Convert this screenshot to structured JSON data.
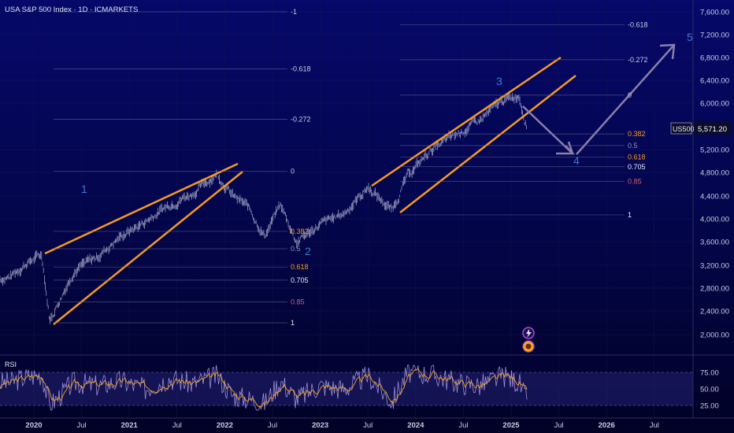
{
  "header": {
    "title": "USA S&P 500 Index · 1D · ICMARKETS"
  },
  "price_axis": {
    "ticks": [
      "7,600.00",
      "7,200.00",
      "6,800.00",
      "6,400.00",
      "6,000.00",
      "5,200.00",
      "4,800.00",
      "4,400.00",
      "4,000.00",
      "3,600.00",
      "3,200.00",
      "2,800.00",
      "2,400.00",
      "2,000.00"
    ],
    "tick_values": [
      7600,
      7200,
      6800,
      6400,
      6000,
      5200,
      4800,
      4400,
      4000,
      3600,
      3200,
      2800,
      2400,
      2000
    ],
    "symbol": "US500",
    "last_price": "5,571.20",
    "last_value": 5571.2
  },
  "time_axis": {
    "labels": [
      "2020",
      "Jul",
      "2021",
      "Jul",
      "2022",
      "Jul",
      "2023",
      "Jul",
      "2024",
      "Jul",
      "2025",
      "Jul",
      "2026",
      "Jul"
    ],
    "bold": [
      true,
      false,
      true,
      false,
      true,
      false,
      true,
      false,
      true,
      false,
      true,
      false,
      true,
      false
    ]
  },
  "rsi": {
    "label": "RSI",
    "ticks": [
      "75.00",
      "50.00",
      "25.00"
    ],
    "tick_values": [
      75,
      50,
      25
    ]
  },
  "fib_left": {
    "levels": [
      {
        "label": "-1",
        "value": 7600,
        "color": "#c8cde0"
      },
      {
        "label": "-0.618",
        "value": 6600,
        "color": "#c8cde0"
      },
      {
        "label": "-0.272",
        "value": 5720,
        "color": "#c8cde0"
      },
      {
        "label": "0",
        "value": 4820,
        "color": "#c8cde0"
      },
      {
        "label": "0.382",
        "value": 3780,
        "color": "#f59a23"
      },
      {
        "label": "0.5",
        "value": 3480,
        "color": "#9098b0"
      },
      {
        "label": "0.618",
        "value": 3170,
        "color": "#f59a23"
      },
      {
        "label": "0.705",
        "value": 2940,
        "color": "#e8ecf5"
      },
      {
        "label": "0.85",
        "value": 2560,
        "color": "#d0606a"
      },
      {
        "label": "1",
        "value": 2200,
        "color": "#e8ecf5"
      }
    ]
  },
  "fib_right": {
    "levels": [
      {
        "label": "-0.618",
        "value": 7370,
        "color": "#c8cde0"
      },
      {
        "label": "-0.272",
        "value": 6760,
        "color": "#c8cde0"
      },
      {
        "label": "0",
        "value": 6140,
        "color": "#c8cde0"
      },
      {
        "label": "0.382",
        "value": 5470,
        "color": "#f59a23"
      },
      {
        "label": "0.5",
        "value": 5270,
        "color": "#9098b0"
      },
      {
        "label": "0.618",
        "value": 5070,
        "color": "#f59a23"
      },
      {
        "label": "0.705",
        "value": 4900,
        "color": "#e8ecf5"
      },
      {
        "label": "0.85",
        "value": 4650,
        "color": "#d0606a"
      },
      {
        "label": "1",
        "value": 4070,
        "color": "#e8ecf5"
      }
    ]
  },
  "wave_labels": [
    "1",
    "2",
    "3",
    "4",
    "5"
  ],
  "colors": {
    "trendline": "#f59a23",
    "projection": "#8a7fa8",
    "wave_label": "#3d78d8",
    "price_bars": "#c8cde0",
    "rsi_line": "#9b8fd8",
    "rsi_signal": "#f5a623",
    "rsi_band": "#7b6fd0"
  },
  "chart_data": {
    "type": "line",
    "title": "USA S&P 500 Index · 1D · ICMARKETS",
    "ylim": [
      1900,
      7700
    ],
    "x": [
      "2019-10",
      "2019-12",
      "2020-02",
      "2020-03",
      "2020-06",
      "2020-09",
      "2020-12",
      "2021-03",
      "2021-06",
      "2021-09",
      "2021-12",
      "2022-02",
      "2022-04",
      "2022-06",
      "2022-08",
      "2022-10",
      "2023-01",
      "2023-04",
      "2023-07",
      "2023-10",
      "2023-12",
      "2024-03",
      "2024-06",
      "2024-09",
      "2024-12",
      "2025-02",
      "2025-03"
    ],
    "series": [
      {
        "name": "US500",
        "values": [
          3000,
          3230,
          3380,
          2240,
          3100,
          3350,
          3700,
          3950,
          4250,
          4450,
          4780,
          4400,
          4200,
          3700,
          4250,
          3600,
          3900,
          4100,
          4550,
          4150,
          4750,
          5200,
          5450,
          5700,
          6050,
          6140,
          5571
        ]
      }
    ],
    "rsi_values": [
      60,
      68,
      72,
      25,
      60,
      55,
      62,
      50,
      66,
      58,
      70,
      40,
      35,
      28,
      62,
      35,
      55,
      50,
      70,
      30,
      75,
      72,
      60,
      55,
      70,
      60,
      30
    ]
  }
}
